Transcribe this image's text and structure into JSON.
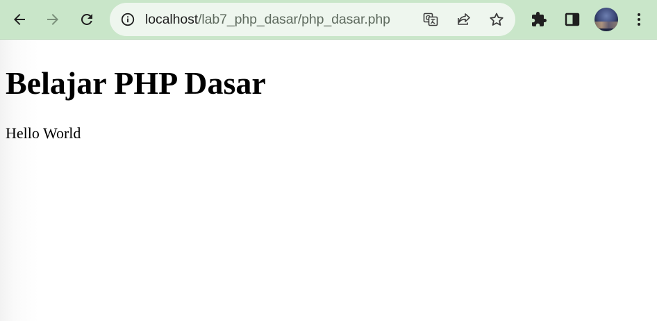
{
  "browser": {
    "url_host": "localhost",
    "url_path": "/lab7_php_dasar/php_dasar.php",
    "icons": {
      "back": "arrow-left-icon",
      "forward": "arrow-right-icon",
      "reload": "reload-icon",
      "site_info": "info-icon",
      "translate": "translate-icon",
      "share": "share-icon",
      "bookmark": "star-icon",
      "extensions": "puzzle-icon",
      "side_panel": "side-panel-icon",
      "menu": "more-vert-icon"
    },
    "colors": {
      "toolbar_bg": "#c9e6c9",
      "omnibox_bg": "#eef6ee",
      "forward_disabled": "#7a8f7a"
    }
  },
  "page": {
    "heading": "Belajar PHP Dasar",
    "paragraph": "Hello World"
  }
}
